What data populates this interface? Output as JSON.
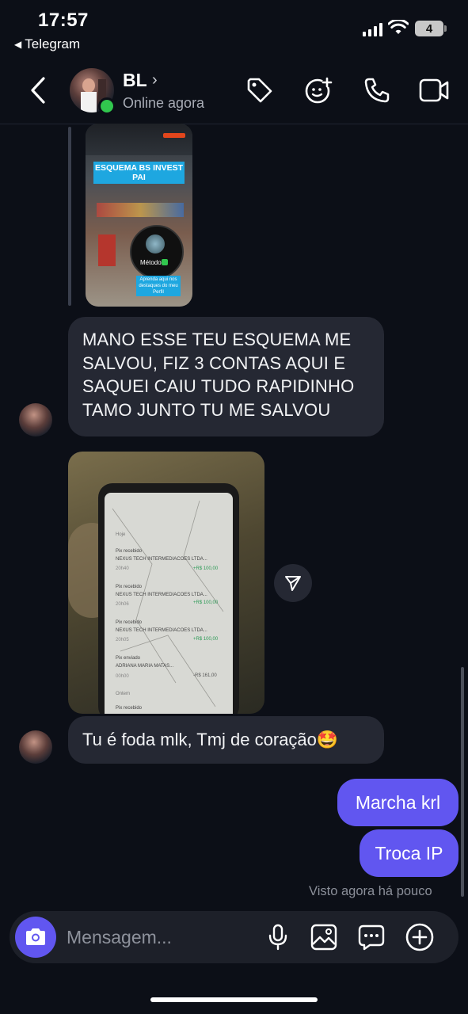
{
  "status_bar": {
    "time": "17:57",
    "back_app": "Telegram",
    "battery": "4"
  },
  "header": {
    "contact_name": "BL",
    "contact_status": "Online agora",
    "icons": [
      "back-chevron-icon",
      "tag-icon",
      "sticker-icon",
      "phone-icon",
      "video-icon"
    ]
  },
  "story": {
    "title_line1": "ESQUEMA BS INVEST",
    "title_line2": "PAI",
    "metodo": "Método",
    "aprenda": "Aprenda aqui nos destaques do meu Perfil"
  },
  "messages": {
    "msg1_lines": [
      "MANO ESSE TEU ESQUEMA ME",
      "SALVOU, FIZ 3 CONTAS AQUI E",
      "SAQUEI CAIU TUDO RAPIDINHO",
      "TAMO JUNTO TU ME SALVOU"
    ],
    "photo": {
      "section_hoje": "Hoje",
      "section_ontem": "Ontem",
      "rows": [
        {
          "type": "Pix recebido",
          "name": "NEXUS TECH INTERMEDIACOES LTDA...",
          "time": "20h40",
          "value": "+R$ 100,00"
        },
        {
          "type": "Pix recebido",
          "name": "NEXUS TECH INTERMEDIACOES LTDA...",
          "time": "20h06",
          "value": "+R$ 100,00"
        },
        {
          "type": "Pix recebido",
          "name": "NEXUS TECH INTERMEDIACOES LTDA...",
          "time": "20h05",
          "value": "+R$ 100,00"
        },
        {
          "type": "Pix enviado",
          "name": "ADRIANA MARIA MATAS...",
          "time": "00h00",
          "value": "-R$ 161,00"
        },
        {
          "type": "Pix recebido",
          "name": "",
          "time": "",
          "value": ""
        }
      ]
    },
    "msg2": "Tu é foda mlk, Tmj de coração🤩",
    "msg3": "Marcha krl",
    "msg4": "Troca IP",
    "seen": "Visto agora há pouco"
  },
  "composer": {
    "placeholder": "Mensagem..."
  },
  "colors": {
    "background": "#0c0f17",
    "incoming_bubble": "#252833",
    "outgoing_bubble": "#6156f0",
    "online": "#31c74e"
  }
}
